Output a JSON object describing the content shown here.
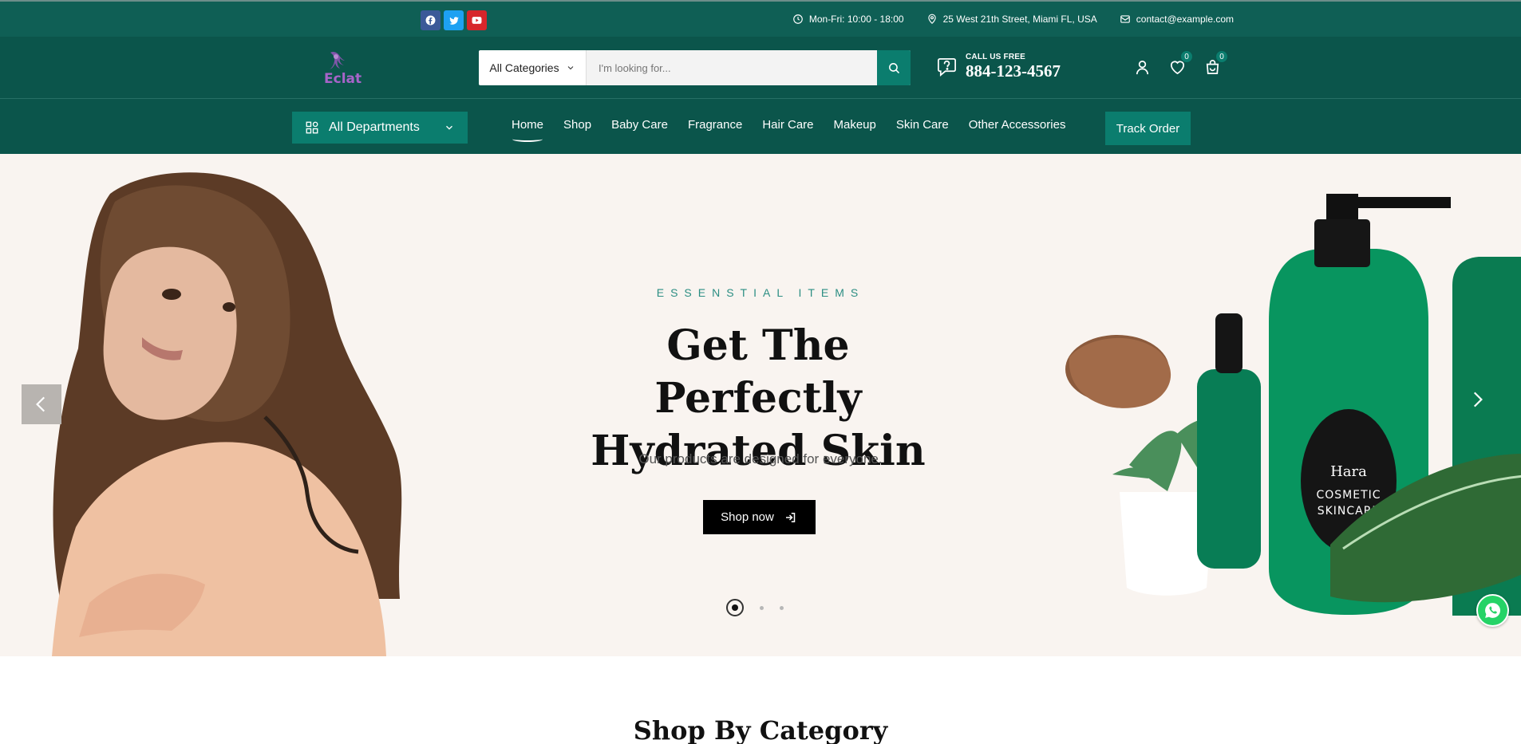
{
  "topbar": {
    "hours": "Mon-Fri: 10:00 - 18:00",
    "address": "25 West 21th Street, Miami FL, USA",
    "email": "contact@example.com"
  },
  "header": {
    "logo_text": "Eclat",
    "category_label": "All Categories",
    "search_placeholder": "I'm looking for...",
    "call_label": "CALL US FREE",
    "phone": "884-123-4567",
    "wishlist_count": "0",
    "cart_count": "0"
  },
  "nav": {
    "departments_label": "All Departments",
    "items": [
      "Home",
      "Shop",
      "Baby Care",
      "Fragrance",
      "Hair Care",
      "Makeup",
      "Skin Care",
      "Other Accessories"
    ],
    "track_label": "Track Order"
  },
  "hero": {
    "subtitle": "ESSENSTIAL ITEMS",
    "title": "Get The Perfectly Hydrated Skin",
    "description": "Our products are designed for everyone.",
    "button": "Shop now",
    "product_brand": "Hara",
    "product_label_1": "COSMETIC",
    "product_label_2": "SKINCARE"
  },
  "section": {
    "title": "Shop By Category"
  }
}
